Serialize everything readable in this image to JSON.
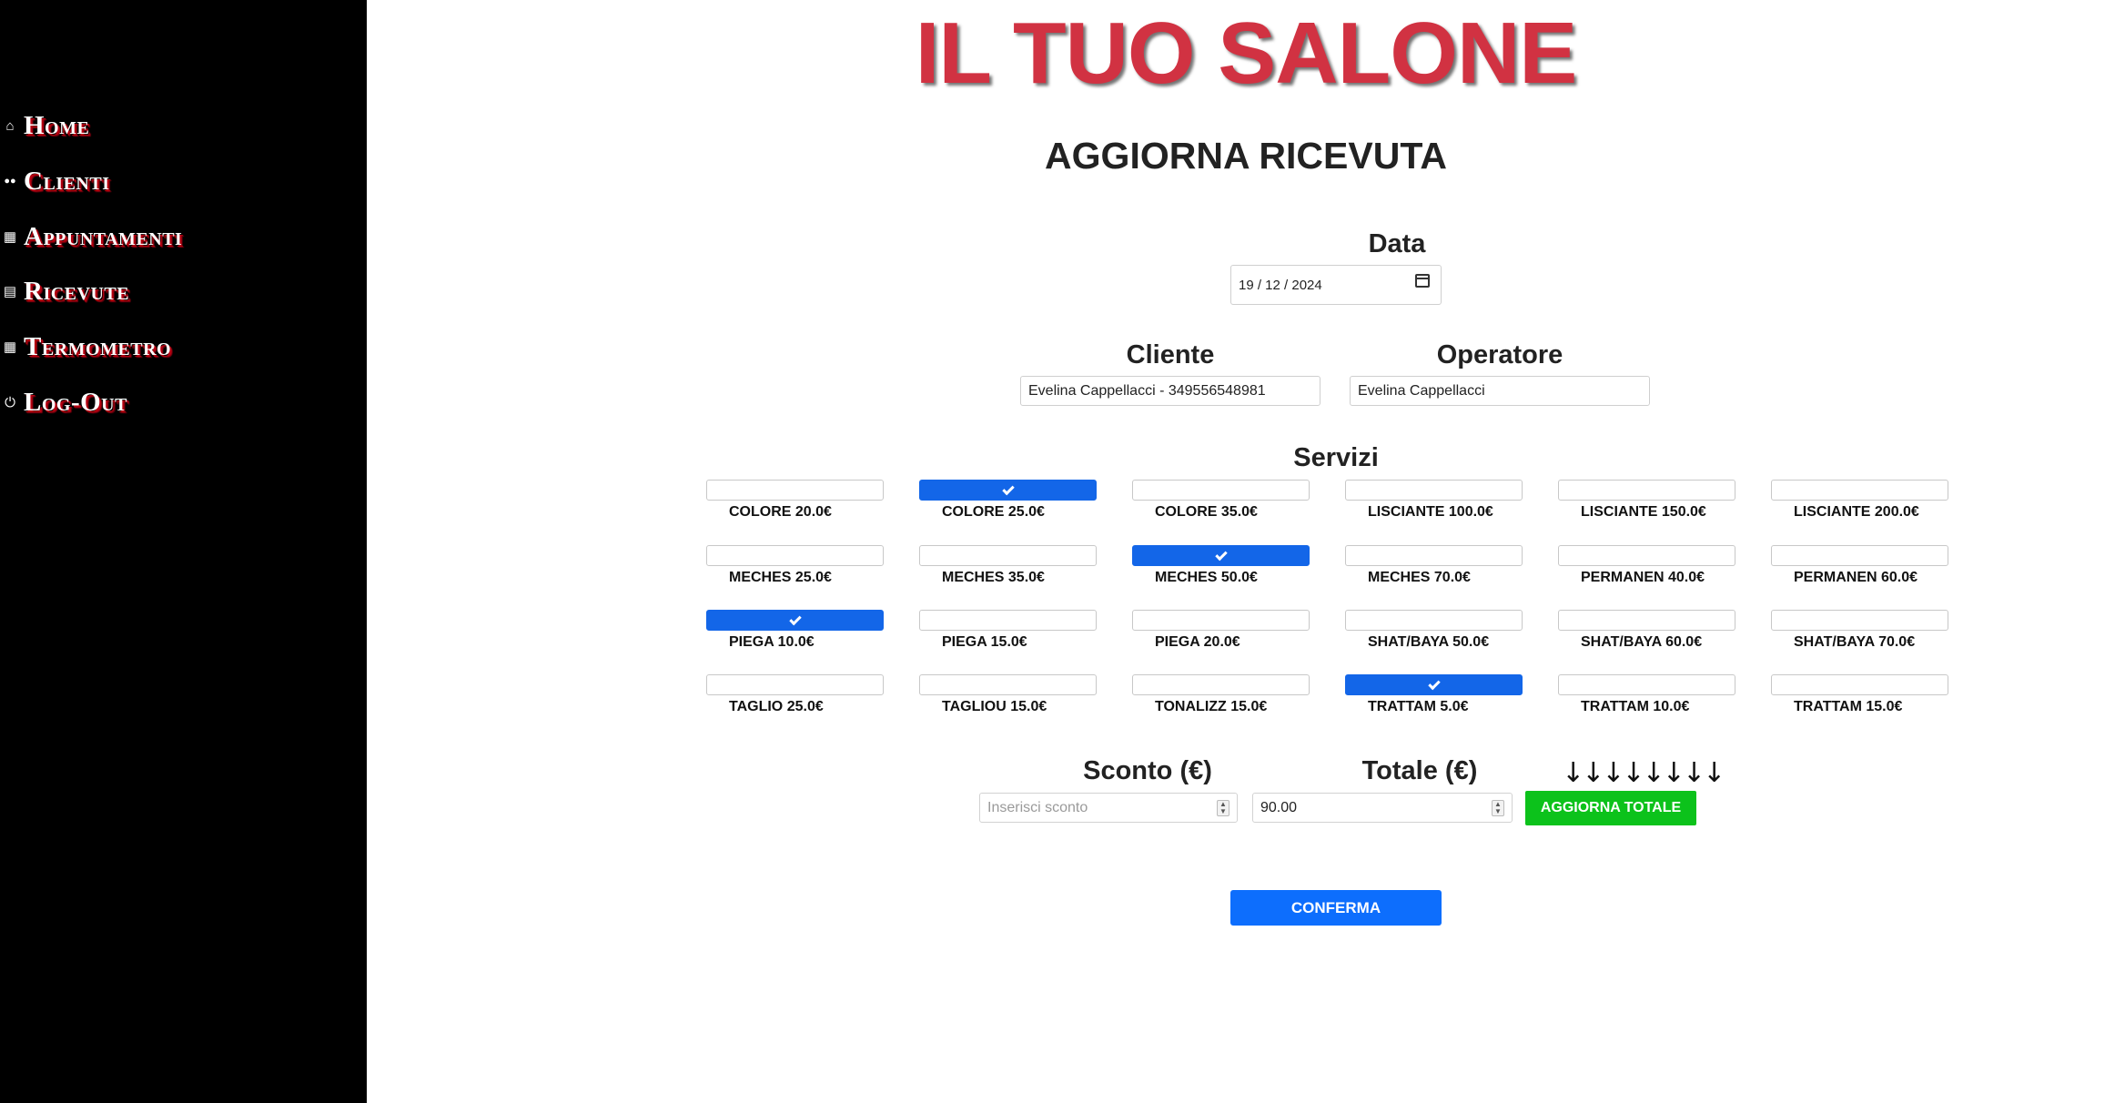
{
  "sidebar": {
    "items": [
      {
        "icon": "home-icon",
        "glyph": "⌂",
        "label": "Home"
      },
      {
        "icon": "users-icon",
        "glyph": "👥",
        "label": "Clienti"
      },
      {
        "icon": "calendar-icon",
        "glyph": "▦",
        "label": "Appuntamenti"
      },
      {
        "icon": "receipt-icon",
        "glyph": "▤",
        "label": "Ricevute"
      },
      {
        "icon": "thermometer-icon",
        "glyph": "▦",
        "label": "Termometro"
      },
      {
        "icon": "power-icon",
        "glyph": "⏻",
        "label": "Log-Out"
      }
    ]
  },
  "brand": "IL TUO SALONE",
  "page_title": "AGGIORNA RICEVUTA",
  "form": {
    "date_label": "Data",
    "date_value": "19 / 12 / 2024",
    "client_label": "Cliente",
    "client_value": "Evelina Cappellacci - 349556548981",
    "operator_label": "Operatore",
    "operator_value": "Evelina Cappellacci",
    "services_label": "Servizi",
    "services": [
      {
        "label": "COLORE 20.0€",
        "checked": false
      },
      {
        "label": "COLORE 25.0€",
        "checked": true
      },
      {
        "label": "COLORE 35.0€",
        "checked": false
      },
      {
        "label": "LISCIANTE 100.0€",
        "checked": false
      },
      {
        "label": "LISCIANTE 150.0€",
        "checked": false
      },
      {
        "label": "LISCIANTE 200.0€",
        "checked": false
      },
      {
        "label": "MECHES 25.0€",
        "checked": false
      },
      {
        "label": "MECHES 35.0€",
        "checked": false
      },
      {
        "label": "MECHES 50.0€",
        "checked": true
      },
      {
        "label": "MECHES 70.0€",
        "checked": false
      },
      {
        "label": "PERMANEN 40.0€",
        "checked": false
      },
      {
        "label": "PERMANEN 60.0€",
        "checked": false
      },
      {
        "label": "PIEGA 10.0€",
        "checked": true
      },
      {
        "label": "PIEGA 15.0€",
        "checked": false
      },
      {
        "label": "PIEGA 20.0€",
        "checked": false
      },
      {
        "label": "SHAT/BAYA 50.0€",
        "checked": false
      },
      {
        "label": "SHAT/BAYA 60.0€",
        "checked": false
      },
      {
        "label": "SHAT/BAYA 70.0€",
        "checked": false
      },
      {
        "label": "TAGLIO 25.0€",
        "checked": false
      },
      {
        "label": "TAGLIOU 15.0€",
        "checked": false
      },
      {
        "label": "TONALIZZ 15.0€",
        "checked": false
      },
      {
        "label": "TRATTAM 5.0€",
        "checked": true
      },
      {
        "label": "TRATTAM 10.0€",
        "checked": false
      },
      {
        "label": "TRATTAM 15.0€",
        "checked": false
      }
    ],
    "discount_label": "Sconto (€)",
    "discount_placeholder": "Inserisci sconto",
    "total_label": "Totale (€)",
    "total_value": "90.00",
    "arrows": "↓↓↓↓↓↓↓↓",
    "update_total_label": "AGGIORNA TOTALE",
    "confirm_label": "CONFERMA"
  }
}
